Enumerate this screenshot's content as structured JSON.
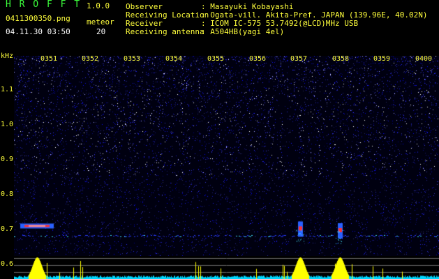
{
  "app": {
    "title": "H R O F F T",
    "version": "1.0.0",
    "file_name": "0411300350.png",
    "datetime": "04.11.30 03:50",
    "meteor_label": "meteor",
    "meteor_count": "20"
  },
  "info": [
    {
      "label": "Observer",
      "value": ": Masayuki Kobayashi"
    },
    {
      "label": "Receiving Location",
      "value": ": Ogata-vill. Akita-Pref. JAPAN (139.96E, 40.02N)"
    },
    {
      "label": "Receiver",
      "value": ": ICOM IC-575 53.7492(@LCD)MHz USB"
    },
    {
      "label": "Receiving antenna",
      "value": ": A504HB(yagi 4el)"
    }
  ],
  "axes": {
    "y_unit": "kHz",
    "y_labels": [
      "1.1",
      "1.0",
      "0.9",
      "0.8",
      "0.7",
      "0.6"
    ],
    "x_labels": [
      "0351",
      "0352",
      "0353",
      "0354",
      "0355",
      "0356",
      "0357",
      "0358",
      "0359",
      "0400"
    ]
  },
  "colors": {
    "header_green": "#3cff3c",
    "axis_yellow": "#ffff3c",
    "noise_blue": "#1a1aa0",
    "echo_red": "#ff3030",
    "spectrum_yellow": "#ffff00",
    "spectrum_cyan": "#00d8ff"
  },
  "events": [
    {
      "time": "0350:48",
      "freq_khz": 0.683,
      "type": "meteor-echo"
    },
    {
      "time": "0357:05",
      "freq_khz": 0.675,
      "type": "meteor-echo"
    },
    {
      "time": "0358:02",
      "freq_khz": 0.67,
      "type": "meteor-echo"
    }
  ]
}
